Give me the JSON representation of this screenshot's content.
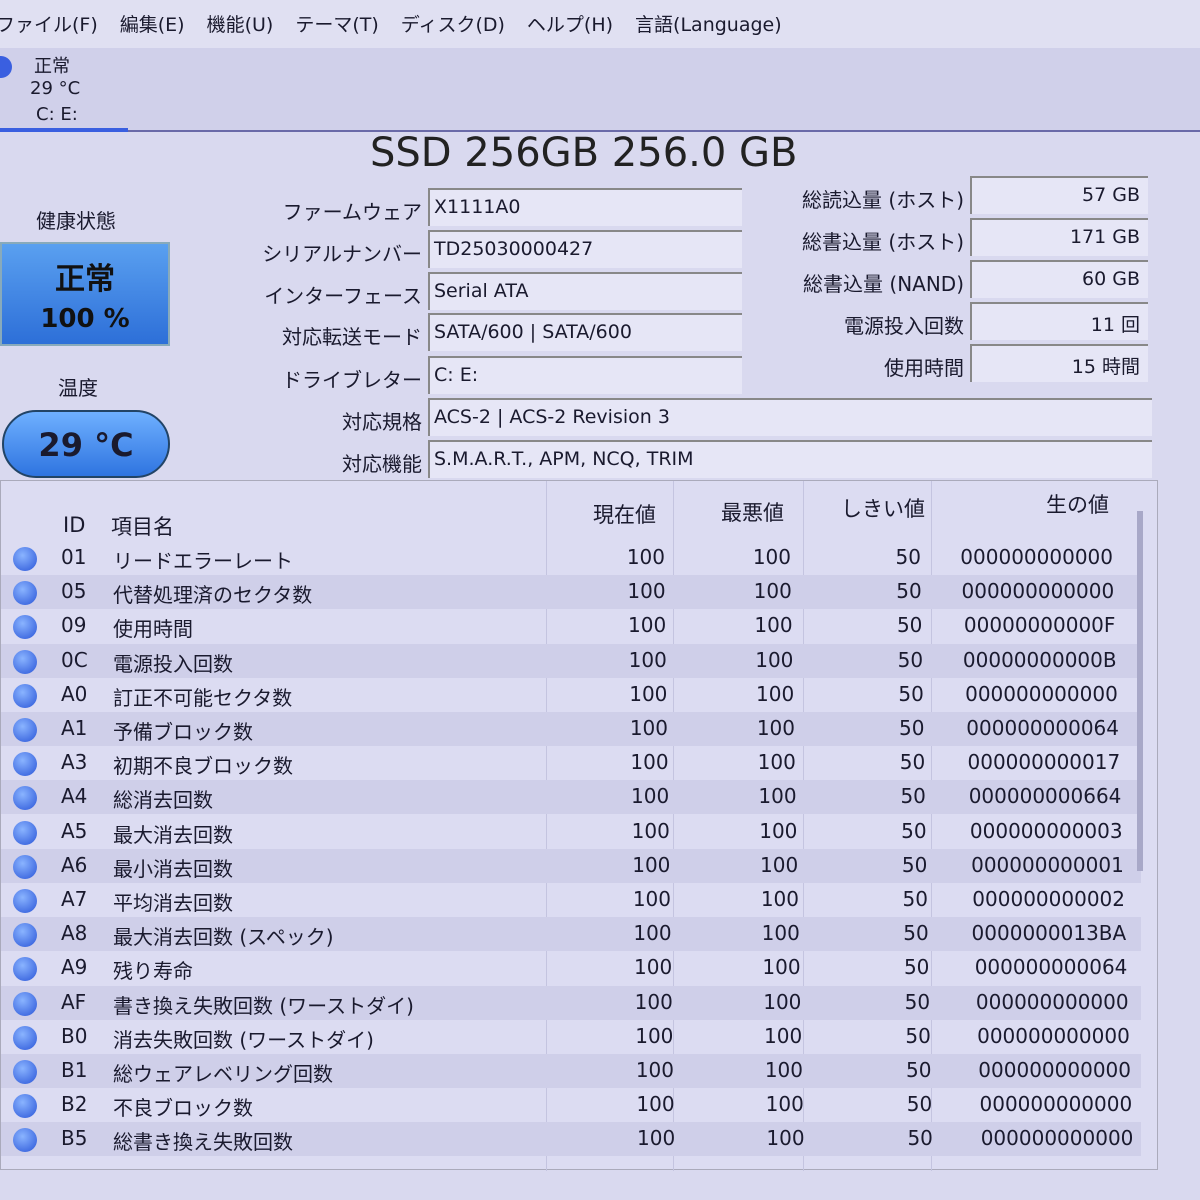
{
  "menu": [
    "ファイル(F)",
    "編集(E)",
    "機能(U)",
    "テーマ(T)",
    "ディスク(D)",
    "ヘルプ(H)",
    "言語(Language)"
  ],
  "drive_tab": {
    "status": "正常",
    "temp": "29 °C",
    "letters": "C: E:"
  },
  "title": "SSD 256GB 256.0 GB",
  "health": {
    "label": "健康状態",
    "status": "正常",
    "percent": "100 %",
    "color": "#3a7fe8"
  },
  "temperature": {
    "label": "温度",
    "value": "29 °C"
  },
  "info": [
    {
      "label": "ファームウェア",
      "value": "X1111A0"
    },
    {
      "label": "シリアルナンバー",
      "value": "TD25030000427"
    },
    {
      "label": "インターフェース",
      "value": "Serial ATA"
    },
    {
      "label": "対応転送モード",
      "value": "SATA/600 | SATA/600"
    },
    {
      "label": "ドライブレター",
      "value": "C: E:"
    },
    {
      "label": "対応規格",
      "value": "ACS-2 | ACS-2 Revision 3"
    },
    {
      "label": "対応機能",
      "value": "S.M.A.R.T., APM, NCQ, TRIM"
    }
  ],
  "stats": [
    {
      "label": "総読込量 (ホスト)",
      "value": "57 GB"
    },
    {
      "label": "総書込量 (ホスト)",
      "value": "171 GB"
    },
    {
      "label": "総書込量 (NAND)",
      "value": "60 GB"
    },
    {
      "label": "電源投入回数",
      "value": "11 回"
    },
    {
      "label": "使用時間",
      "value": "15 時間"
    }
  ],
  "table": {
    "headers": {
      "id": "ID",
      "name": "項目名",
      "current": "現在値",
      "worst": "最悪値",
      "threshold": "しきい値",
      "raw": "生の値"
    },
    "rows": [
      [
        "01",
        "リードエラーレート",
        "100",
        "100",
        "50",
        "000000000000"
      ],
      [
        "05",
        "代替処理済のセクタ数",
        "100",
        "100",
        "50",
        "000000000000"
      ],
      [
        "09",
        "使用時間",
        "100",
        "100",
        "50",
        "00000000000F"
      ],
      [
        "0C",
        "電源投入回数",
        "100",
        "100",
        "50",
        "00000000000B"
      ],
      [
        "A0",
        "訂正不可能セクタ数",
        "100",
        "100",
        "50",
        "000000000000"
      ],
      [
        "A1",
        "予備ブロック数",
        "100",
        "100",
        "50",
        "000000000064"
      ],
      [
        "A3",
        "初期不良ブロック数",
        "100",
        "100",
        "50",
        "000000000017"
      ],
      [
        "A4",
        "総消去回数",
        "100",
        "100",
        "50",
        "000000000664"
      ],
      [
        "A5",
        "最大消去回数",
        "100",
        "100",
        "50",
        "000000000003"
      ],
      [
        "A6",
        "最小消去回数",
        "100",
        "100",
        "50",
        "000000000001"
      ],
      [
        "A7",
        "平均消去回数",
        "100",
        "100",
        "50",
        "000000000002"
      ],
      [
        "A8",
        "最大消去回数 (スペック)",
        "100",
        "100",
        "50",
        "0000000013BA"
      ],
      [
        "A9",
        "残り寿命",
        "100",
        "100",
        "50",
        "000000000064"
      ],
      [
        "AF",
        "書き換え失敗回数 (ワーストダイ)",
        "100",
        "100",
        "50",
        "000000000000"
      ],
      [
        "B0",
        "消去失敗回数 (ワーストダイ)",
        "100",
        "100",
        "50",
        "000000000000"
      ],
      [
        "B1",
        "総ウェアレベリング回数",
        "100",
        "100",
        "50",
        "000000000000"
      ],
      [
        "B2",
        "不良ブロック数",
        "100",
        "100",
        "50",
        "000000000000"
      ],
      [
        "B5",
        "総書き換え失敗回数",
        "100",
        "100",
        "50",
        "000000000000"
      ]
    ]
  }
}
